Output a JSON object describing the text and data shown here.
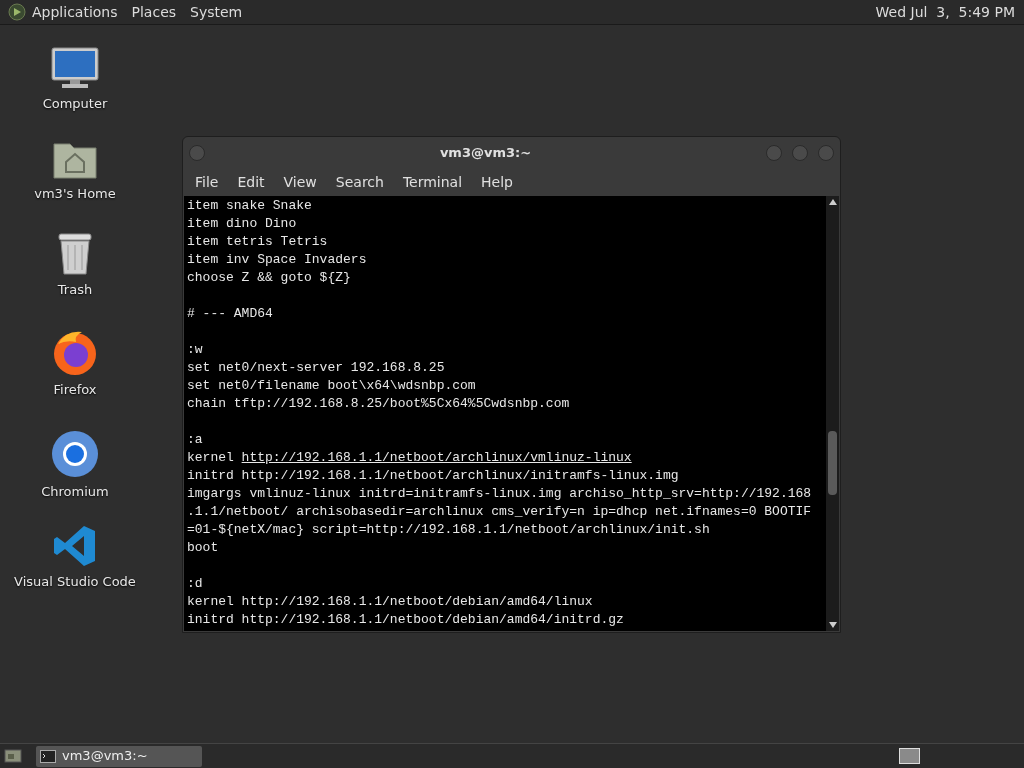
{
  "top_panel": {
    "menus": [
      "Applications",
      "Places",
      "System"
    ],
    "clock": "Wed Jul  3,  5:49 PM"
  },
  "desktop_icons": [
    {
      "kind": "computer",
      "label": "Computer"
    },
    {
      "kind": "home",
      "label": "vm3's Home"
    },
    {
      "kind": "trash",
      "label": "Trash"
    },
    {
      "kind": "firefox",
      "label": "Firefox"
    },
    {
      "kind": "chromium",
      "label": "Chromium"
    },
    {
      "kind": "vscode",
      "label": "Visual Studio Code"
    }
  ],
  "terminal": {
    "title": "vm3@vm3:~",
    "menus": [
      "File",
      "Edit",
      "View",
      "Search",
      "Terminal",
      "Help"
    ],
    "blocks": [
      {
        "lines": [
          {
            "text": "item snake Snake"
          },
          {
            "text": "item dino Dino"
          },
          {
            "text": "item tetris Tetris"
          },
          {
            "text": "item inv Space Invaders"
          },
          {
            "text": "choose Z && goto ${Z}"
          }
        ]
      },
      {
        "lines": [
          {
            "text": "# --- AMD64"
          }
        ]
      },
      {
        "lines": [
          {
            "text": ":w"
          },
          {
            "text": "set net0/next-server 192.168.8.25"
          },
          {
            "text": "set net0/filename boot\\x64\\wdsnbp.com"
          },
          {
            "text": "chain tftp://192.168.8.25/boot%5Cx64%5Cwdsnbp.com"
          }
        ]
      },
      {
        "lines": [
          {
            "text": ":a"
          },
          {
            "text": "kernel ",
            "link": "http://192.168.1.1/netboot/archlinux/vmlinuz-linux"
          },
          {
            "text": "initrd http://192.168.1.1/netboot/archlinux/initramfs-linux.img"
          },
          {
            "text": "imgargs vmlinuz-linux initrd=initramfs-linux.img archiso_http_srv=http://192.168"
          },
          {
            "text": ".1.1/netboot/ archisobasedir=archlinux cms_verify=n ip=dhcp net.ifnames=0 BOOTIF"
          },
          {
            "text": "=01-${netX/mac} script=http://192.168.1.1/netboot/archlinux/init.sh"
          },
          {
            "text": "boot"
          }
        ]
      },
      {
        "lines": [
          {
            "text": ":d"
          },
          {
            "text": "kernel http://192.168.1.1/netboot/debian/amd64/linux"
          },
          {
            "text": "initrd http://192.168.1.1/netboot/debian/amd64/initrd.gz"
          }
        ]
      }
    ]
  },
  "taskbar": {
    "tasks": [
      {
        "label": "vm3@vm3:~",
        "selected": true
      }
    ]
  }
}
